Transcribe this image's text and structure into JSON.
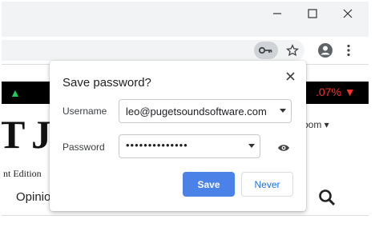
{
  "window": {
    "controls": [
      "minimize-icon",
      "maximize-icon",
      "close-icon"
    ]
  },
  "toolbar": {
    "icons": [
      "key-icon",
      "star-icon",
      "account-icon",
      "menu-icon"
    ]
  },
  "page_behind": {
    "ticker_value": ".07% ▼",
    "masthead": "T JO",
    "edition": "nt Edition",
    "nav_item": "Opinion",
    "zoom": "oom ▾"
  },
  "dialog": {
    "title": "Save password?",
    "username_label": "Username",
    "username_value": "leo@pugetsoundsoftware.com",
    "password_label": "Password",
    "password_value": "••••••••••••••",
    "save_label": "Save",
    "never_label": "Never"
  },
  "colors": {
    "accent": "#4a82e8",
    "link": "#1a73e8",
    "ticker_down": "#ff2d2d",
    "ticker_up": "#22c55e"
  }
}
